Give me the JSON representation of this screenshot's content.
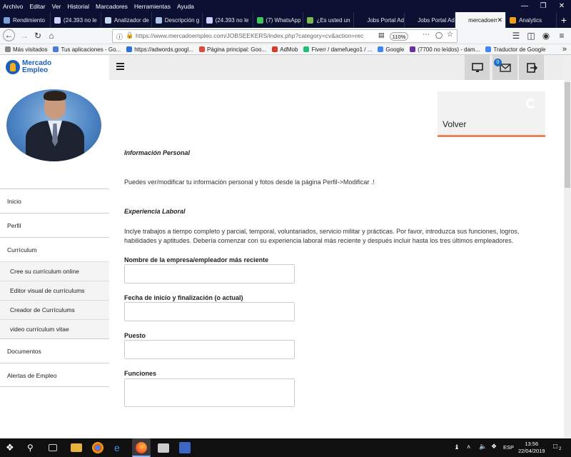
{
  "menubar": {
    "items": [
      "Archivo",
      "Editar",
      "Ver",
      "Historial",
      "Marcadores",
      "Herramientas",
      "Ayuda"
    ]
  },
  "tabs": [
    {
      "label": "Rendimiento",
      "color": "#7aa0d6"
    },
    {
      "label": "(24.393 no le",
      "color": "#d0d0ff"
    },
    {
      "label": "Analizador de",
      "color": "#c6d8ee"
    },
    {
      "label": "Descripción g",
      "color": "#aac3e6"
    },
    {
      "label": "(24.393 no le",
      "color": "#d0d0ff"
    },
    {
      "label": "(7) WhatsApp",
      "color": "#3ec55b"
    },
    {
      "label": "¿Es usted un",
      "color": "#78b84f"
    },
    {
      "label": "Jobs Portal Adm",
      "color": "#0c1033"
    },
    {
      "label": "Jobs Portal Adm",
      "color": "#0c1033"
    },
    {
      "label": "mercadoempl",
      "color": "#f5f6f7"
    },
    {
      "label": "Analytics",
      "color": "#f29d16"
    }
  ],
  "url": "https://www.mercadoempleo.com/JOBSEEKERS/index.php?category=cv&action=rec",
  "zoom": "110%",
  "bookmarks": [
    {
      "label": "Más visitados",
      "color": "#888"
    },
    {
      "label": "Tus aplicaciones - Go...",
      "color": "#4a7bd4"
    },
    {
      "label": "https://adwords.googl...",
      "color": "#2f6fd8"
    },
    {
      "label": "Página principal: Goo...",
      "color": "#e04b37"
    },
    {
      "label": "AdMob",
      "color": "#d93b2b"
    },
    {
      "label": "Fiverr / damefuego1 / ...",
      "color": "#1dbf73"
    },
    {
      "label": "Google",
      "color": "#4285f4"
    },
    {
      "label": "(7700 no leídos) - dam...",
      "color": "#6b2fa4"
    },
    {
      "label": "Traductor de Google",
      "color": "#4285f4"
    }
  ],
  "logo": {
    "line1": "Mercado",
    "line2": "Empleo"
  },
  "sidebar": {
    "items": [
      {
        "label": "Inicio"
      },
      {
        "label": "Perfil"
      },
      {
        "label": "Currículum"
      }
    ],
    "subitems": [
      {
        "label": "Cree su currículum online"
      },
      {
        "label": "Editor visual de currículums"
      },
      {
        "label": "Creador de Currículums"
      },
      {
        "label": "video currículum vitae"
      }
    ],
    "items2": [
      {
        "label": "Documentos"
      },
      {
        "label": "Alertas de Empleo"
      }
    ]
  },
  "topbar": {
    "badge_count": "0"
  },
  "volver": {
    "label": "Volver"
  },
  "content": {
    "info_heading": "Información Personal",
    "info_text": "Puedes ver/modificar tu información personal y fotos desde la página Perfil->Modificar .!",
    "exp_heading": "Experiencia Laboral",
    "exp_text": "Inclye trabajos a tiempo completo y parcial, temporal, voluntariados, servicio militar y prácticas. Por favor, introduzca sus funciones, logros, habilidades y aptitudes. Debería comenzar con su experiencia laboral más reciente y después incluir hasta los tres últimos empleadores.",
    "field1": "Nombre de la empresa/empleador más reciente",
    "field2": "Fecha de inicio y finalización (o actual)",
    "field3": "Puesto",
    "field4": "Funciones"
  },
  "taskbar": {
    "lang": "ESP",
    "time": "13:56",
    "date": "22/04/2019",
    "notif": "2"
  }
}
